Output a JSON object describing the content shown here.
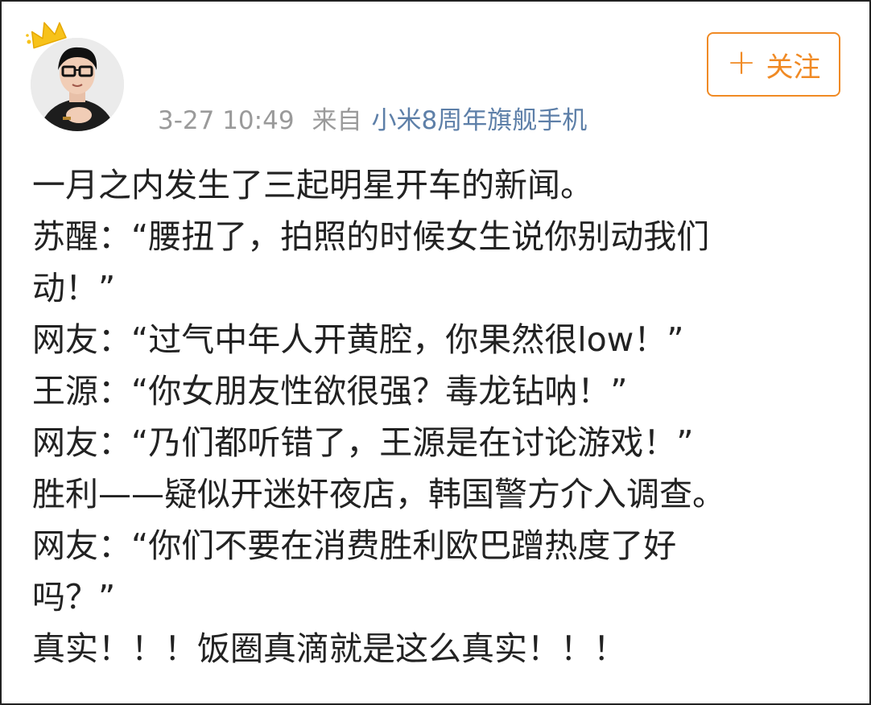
{
  "post": {
    "meta": {
      "timestamp": "3-27 10:49",
      "from_label": "来自",
      "source": "小米8周年旗舰手机"
    },
    "follow_button": {
      "icon": "plus-icon",
      "label": "关注",
      "accent_color": "#f08a24"
    },
    "content_lines": [
      "一月之内发生了三起明星开车的新闻。",
      "苏醒：“腰扭了，拍照的时候女生说你别动我们",
      "动！”",
      "网友：“过气中年人开黄腔，你果然很low！”",
      "王源：“你女朋友性欲很强？毒龙钻呐！”",
      "网友：“乃们都听错了，王源是在讨论游戏！”",
      "胜利——疑似开迷奸夜店，韩国警方介入调查。",
      "网友：“你们不要在消费胜利欧巴蹭热度了好",
      "吗？”",
      "真实！！！饭圈真滴就是这么真实！！！"
    ]
  }
}
